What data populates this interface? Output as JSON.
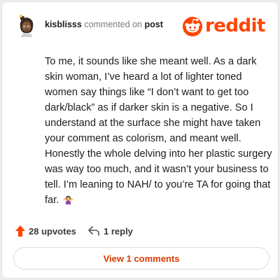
{
  "comment": {
    "username": "kisblisss",
    "action_text": "commented on",
    "post_link": "post",
    "body": "To me, it sounds like she meant well. As a dark skin woman, I’ve heard a lot of lighter toned women say things like “I don’t want to get too dark/black” as if darker skin is a negative. So I understand at the surface she might have taken your comment as colorism, and meant well. Honestly the whole delving into her plastic surgery was way too much, and it wasn’t your business to tell. I’m leaning to NAH/ to you’re TA for going that far.",
    "emoji_icon": "woman-shrugging-icon"
  },
  "brand": {
    "wordmark": "reddit",
    "accent_color": "#ff4500"
  },
  "actions": {
    "upvotes_label": "28 upvotes",
    "reply_label": "1 reply"
  },
  "footer": {
    "view_comments_label": "View 1 comments"
  }
}
